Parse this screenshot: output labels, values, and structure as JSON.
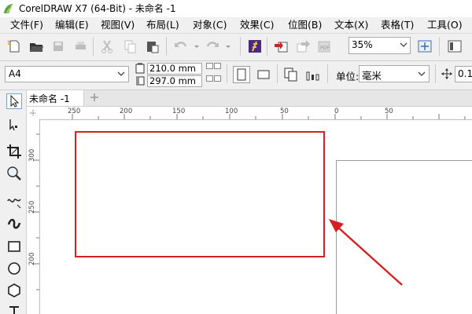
{
  "window": {
    "title": "CorelDRAW X7 (64-Bit) - 未命名 -1"
  },
  "menu": {
    "items": [
      {
        "label": "文件(F)"
      },
      {
        "label": "编辑(E)"
      },
      {
        "label": "视图(V)"
      },
      {
        "label": "布局(L)"
      },
      {
        "label": "对象(C)"
      },
      {
        "label": "效果(C)"
      },
      {
        "label": "位图(B)"
      },
      {
        "label": "文本(X)"
      },
      {
        "label": "表格(T)"
      },
      {
        "label": "工具(O)"
      }
    ]
  },
  "toolbar": {
    "zoom": "35%",
    "icons": [
      "new-document-icon",
      "open-icon",
      "save-icon",
      "print-icon",
      "cut-icon",
      "copy-icon",
      "paste-icon",
      "undo-icon",
      "redo-icon",
      "corel-connect-icon",
      "import-icon",
      "export-icon",
      "publish-pdf-icon",
      "full-screen-icon",
      "snap-to-icon"
    ]
  },
  "property_bar": {
    "page_size": "A4",
    "width": "210.0 mm",
    "height": "297.0 mm",
    "units_label": "单位:",
    "units": "毫米",
    "nudge": "0.1"
  },
  "document_tab": {
    "label": "未命名 -1"
  },
  "ruler": {
    "horizontal_labels": [
      "250",
      "200",
      "150",
      "100",
      "50",
      "0",
      "50"
    ],
    "vertical_labels": [
      "300",
      "250",
      "200"
    ]
  },
  "colors": {
    "highlight": "#d32021",
    "arrow": "#d32021"
  }
}
